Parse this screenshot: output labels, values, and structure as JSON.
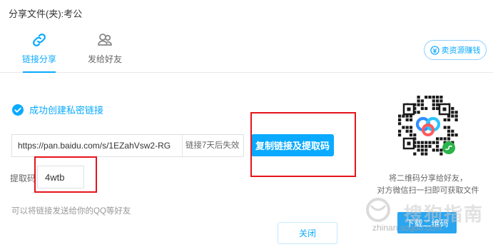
{
  "window": {
    "title": "分享文件(夹):考公"
  },
  "tabs": [
    {
      "label": "链接分享",
      "icon": "link-icon",
      "active": true
    },
    {
      "label": "发给好友",
      "icon": "friends-icon",
      "active": false
    }
  ],
  "sell": {
    "label": "卖资源赚钱",
    "icon": "coin-icon"
  },
  "success": {
    "text": "成功创建私密链接",
    "icon": "check-circle-icon"
  },
  "link": {
    "value": "https://pan.baidu.com/s/1EZahVsw2-RG",
    "expire": "链接7天后失效"
  },
  "copy_button": {
    "label": "复制链接及提取码"
  },
  "code": {
    "label": "提取码",
    "value": "4wtb"
  },
  "hint": "可以将链接发送给你的QQ等好友",
  "close_button": {
    "label": "关闭"
  },
  "qr": {
    "caption_line1": "将二维码分享给好友，",
    "caption_line2": "对方微信扫一扫即可获取文件",
    "download_label": "下载二维码"
  },
  "watermark": {
    "title": "搜狗指南",
    "url": "zhinan.sogou.com"
  },
  "colors": {
    "accent": "#09aaff",
    "annotation": "#e6141c",
    "wechat_green": "#2bb34a"
  }
}
